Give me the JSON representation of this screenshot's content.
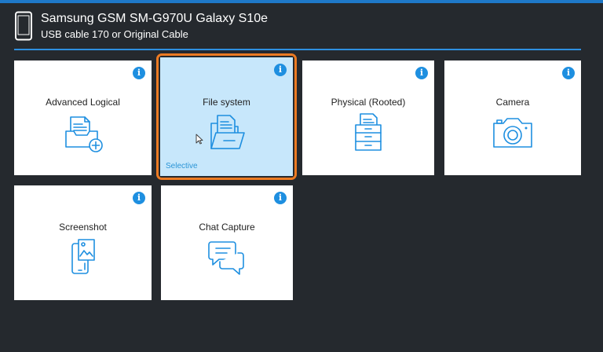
{
  "device": {
    "name": "Samsung GSM SM-G970U Galaxy S10e",
    "connection": "USB cable 170 or Original Cable",
    "icon": "phone-icon"
  },
  "colors": {
    "background": "#25292e",
    "accent": "#1e8fe0",
    "selected_tile": "#c7e7fb",
    "highlight_border": "#ec7a22"
  },
  "tiles": [
    {
      "label": "Advanced Logical",
      "icon": "advanced-logical-icon",
      "info": "i"
    },
    {
      "label": "File system",
      "icon": "file-system-icon",
      "info": "i",
      "tag": "Selective",
      "selected": true
    },
    {
      "label": "Physical (Rooted)",
      "icon": "physical-icon",
      "info": "i"
    },
    {
      "label": "Camera",
      "icon": "camera-icon",
      "info": "i"
    },
    {
      "label": "Screenshot",
      "icon": "screenshot-icon",
      "info": "i"
    },
    {
      "label": "Chat Capture",
      "icon": "chat-capture-icon",
      "info": "i"
    }
  ]
}
